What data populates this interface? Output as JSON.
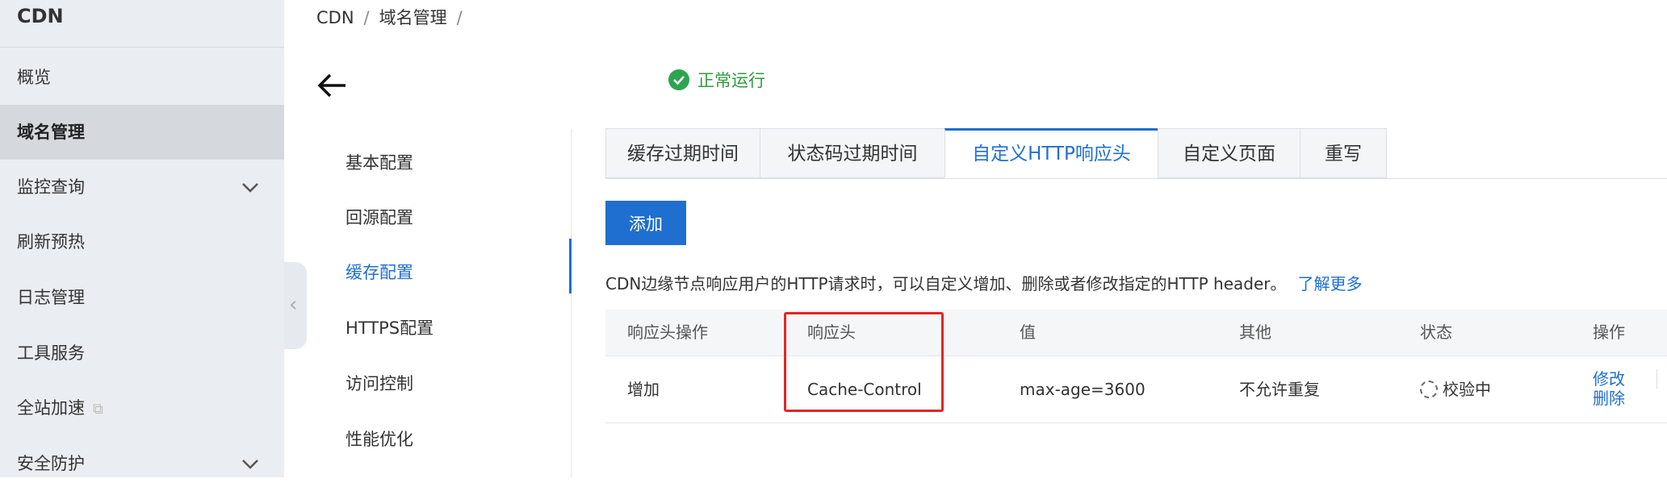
{
  "sidebar": {
    "title": "CDN",
    "items": [
      {
        "label": "概览"
      },
      {
        "label": "域名管理"
      },
      {
        "label": "监控查询"
      },
      {
        "label": "刷新预热"
      },
      {
        "label": "日志管理"
      },
      {
        "label": "工具服务"
      },
      {
        "label": "全站加速"
      },
      {
        "label": "安全防护"
      }
    ]
  },
  "breadcrumb": [
    "CDN",
    "/",
    "域名管理",
    "/"
  ],
  "domain": {
    "status": "正常运行"
  },
  "config_menu": [
    {
      "label": "基本配置"
    },
    {
      "label": "回源配置"
    },
    {
      "label": "缓存配置"
    },
    {
      "label": "HTTPS配置"
    },
    {
      "label": "访问控制"
    },
    {
      "label": "性能优化"
    }
  ],
  "tabs": [
    {
      "label": "缓存过期时间"
    },
    {
      "label": "状态码过期时间"
    },
    {
      "label": "自定义HTTP响应头"
    },
    {
      "label": "自定义页面"
    },
    {
      "label": "重写"
    }
  ],
  "add_button": "添加",
  "description": "CDN边缘节点响应用户的HTTP请求时，可以自定义增加、删除或者修改指定的HTTP header。",
  "learn_more": "了解更多",
  "table": {
    "headers": [
      "响应头操作",
      "响应头",
      "值",
      "其他",
      "状态",
      "操作"
    ],
    "rows": [
      {
        "op": "增加",
        "header": "Cache-Control",
        "value": "max-age=3600",
        "other": "不允许重复",
        "status": "校验中",
        "actions": [
          "修改",
          "删除"
        ]
      }
    ]
  },
  "colors": {
    "accent": "#1f6fd1",
    "success": "#2e9b3f",
    "highlight": "#e52424"
  }
}
